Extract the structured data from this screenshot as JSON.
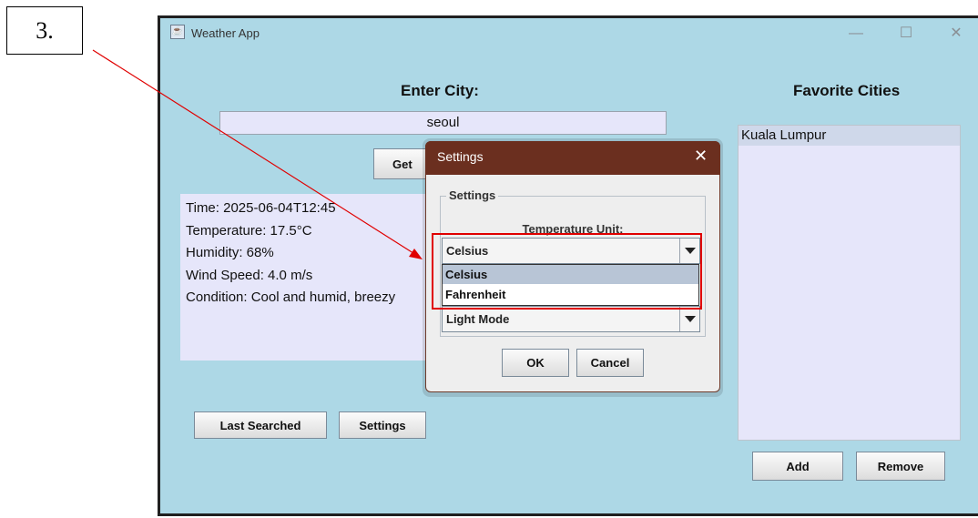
{
  "annotation": {
    "step_label": "3."
  },
  "window": {
    "title": "Weather App",
    "controls": {
      "minimize": "—",
      "maximize": "☐",
      "close": "✕"
    }
  },
  "main": {
    "enter_city_label": "Enter City:",
    "city_value": "seoul",
    "get_weather_button": "Get",
    "weather_info": [
      "Time: 2025-06-04T12:45",
      "Temperature: 17.5°C",
      "Humidity: 68%",
      "Wind Speed: 4.0 m/s",
      "Condition: Cool and humid, breezy"
    ],
    "last_searched_button": "Last Searched",
    "settings_button": "Settings"
  },
  "favorites": {
    "title": "Favorite Cities",
    "items": [
      "Kuala Lumpur"
    ],
    "add_button": "Add",
    "remove_button": "Remove"
  },
  "settings_dialog": {
    "title": "Settings",
    "close": "✕",
    "group_label": "Settings",
    "temperature_unit_label": "Temperature Unit:",
    "temperature_unit_selected": "Celsius",
    "temperature_unit_options": [
      "Celsius",
      "Fahrenheit"
    ],
    "theme_selected": "Light Mode",
    "ok_button": "OK",
    "cancel_button": "Cancel"
  },
  "colors": {
    "window_bg": "#add8e6",
    "panel_bg": "#e6e6fa",
    "dialog_titlebar": "#6b2f1f",
    "highlight": "#e00000",
    "arrow": "#e00000"
  }
}
